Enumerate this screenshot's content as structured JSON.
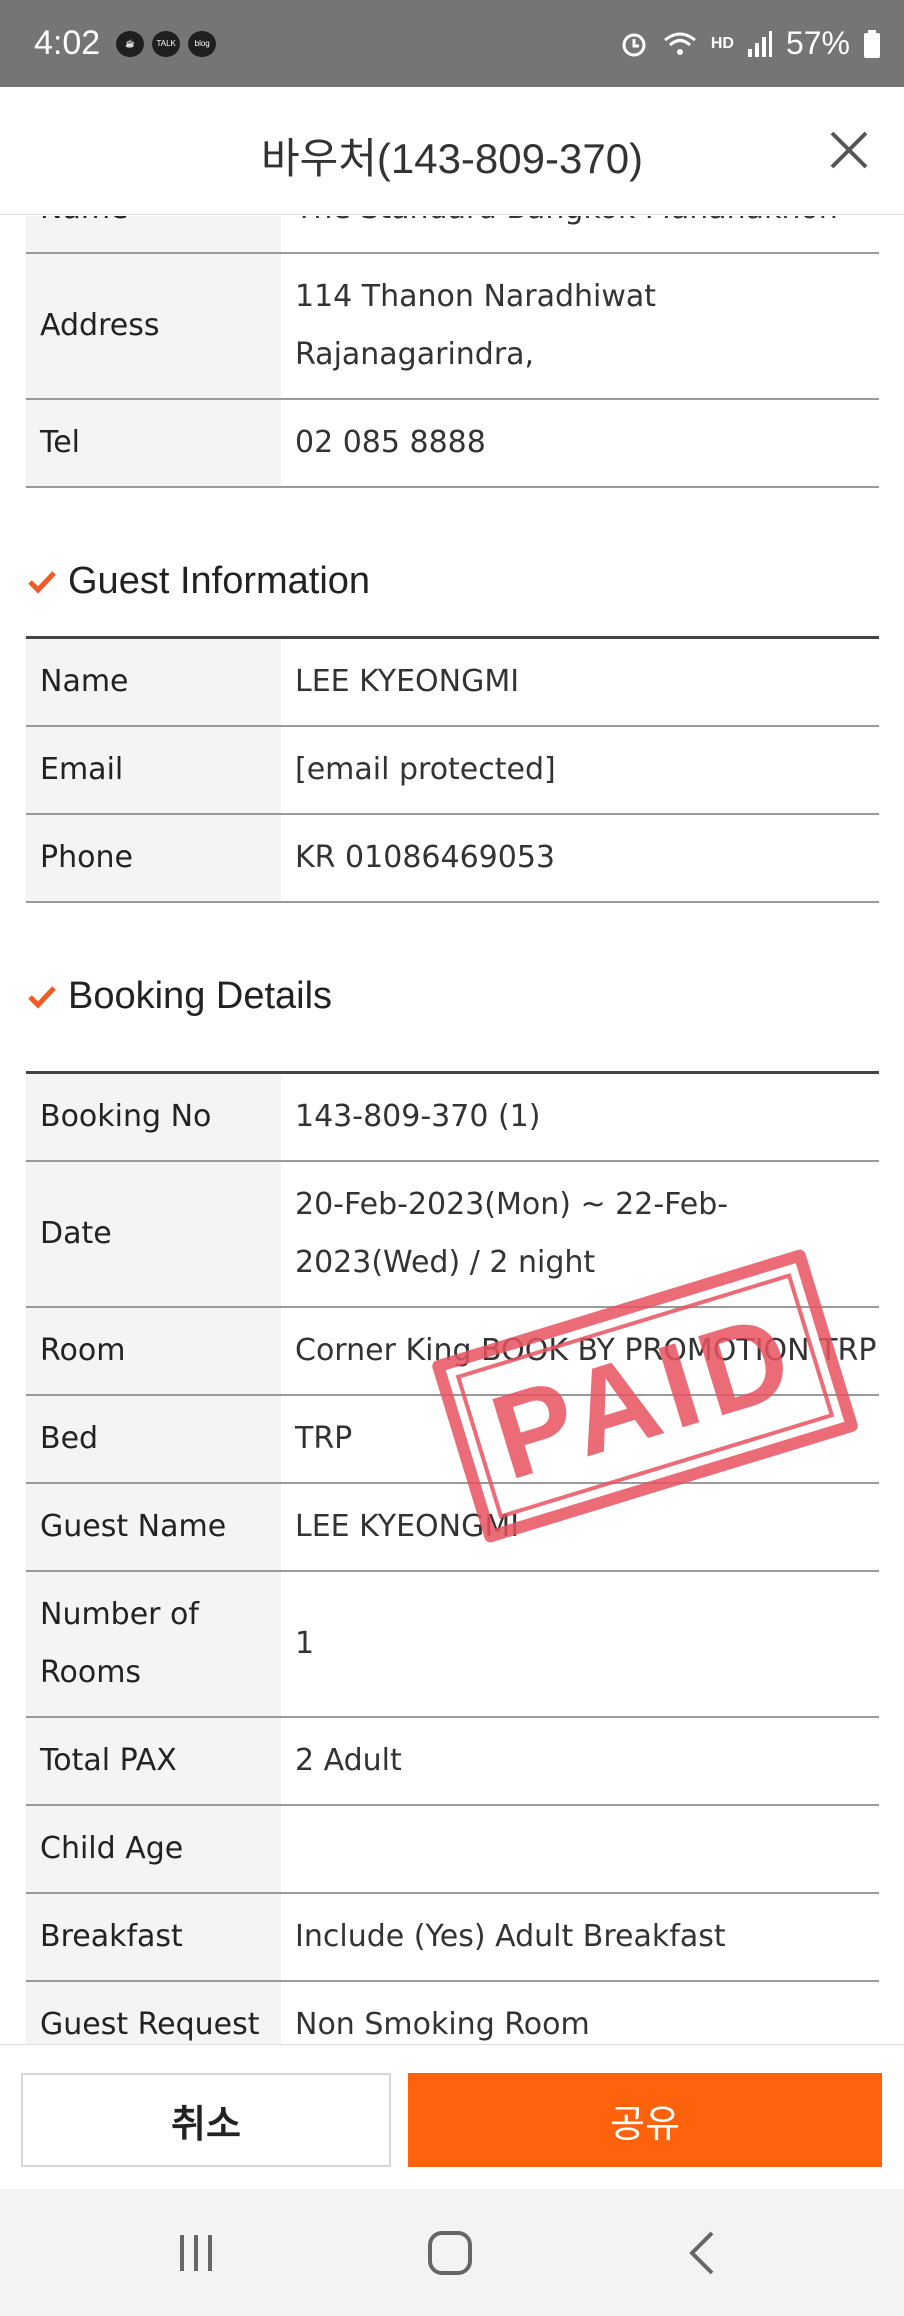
{
  "status_bar": {
    "time": "4:02",
    "app_icons": [
      "TALK",
      "blog"
    ],
    "battery": "57%",
    "hd_label": "HD"
  },
  "header": {
    "title": "바우처(143-809-370)"
  },
  "hotel": {
    "rows": [
      {
        "label": "Name",
        "value": "The Standard Bangkok Mahanakhon"
      },
      {
        "label": "Address",
        "value": "114 Thanon Naradhiwat Rajanagarindra,"
      },
      {
        "label": "Tel",
        "value": "02 085 8888"
      }
    ]
  },
  "guest_info": {
    "title": "Guest Information",
    "rows": [
      {
        "label": "Name",
        "value": "LEE KYEONGMI"
      },
      {
        "label": "Email",
        "value": "[email protected]"
      },
      {
        "label": "Phone",
        "value": "KR 01086469053"
      }
    ]
  },
  "booking_details": {
    "title": "Booking Details",
    "rows": [
      {
        "label": "Booking No",
        "value": "143-809-370 (1)"
      },
      {
        "label": "Date",
        "value": "20-Feb-2023(Mon) ~ 22-Feb-2023(Wed) / 2 night"
      },
      {
        "label": "Room",
        "value": "Corner King BOOK BY PROMOTION TRP"
      },
      {
        "label": "Bed",
        "value": "TRP"
      },
      {
        "label": "Guest Name",
        "value": "LEE KYEONGMI"
      },
      {
        "label": "Number of Rooms",
        "value": "1"
      },
      {
        "label": "Total PAX",
        "value": "2 Adult"
      },
      {
        "label": "Child Age",
        "value": ""
      },
      {
        "label": "Breakfast",
        "value": "Include (Yes) Adult Breakfast"
      },
      {
        "label": "Guest Request",
        "value": "Non Smoking Room"
      }
    ]
  },
  "stamp": {
    "text": "PAID",
    "color": "#e8525f"
  },
  "buttons": {
    "cancel": "취소",
    "share": "공유",
    "share_color": "#ff620d"
  },
  "icons": {
    "check": "check-icon",
    "close": "close-icon"
  }
}
